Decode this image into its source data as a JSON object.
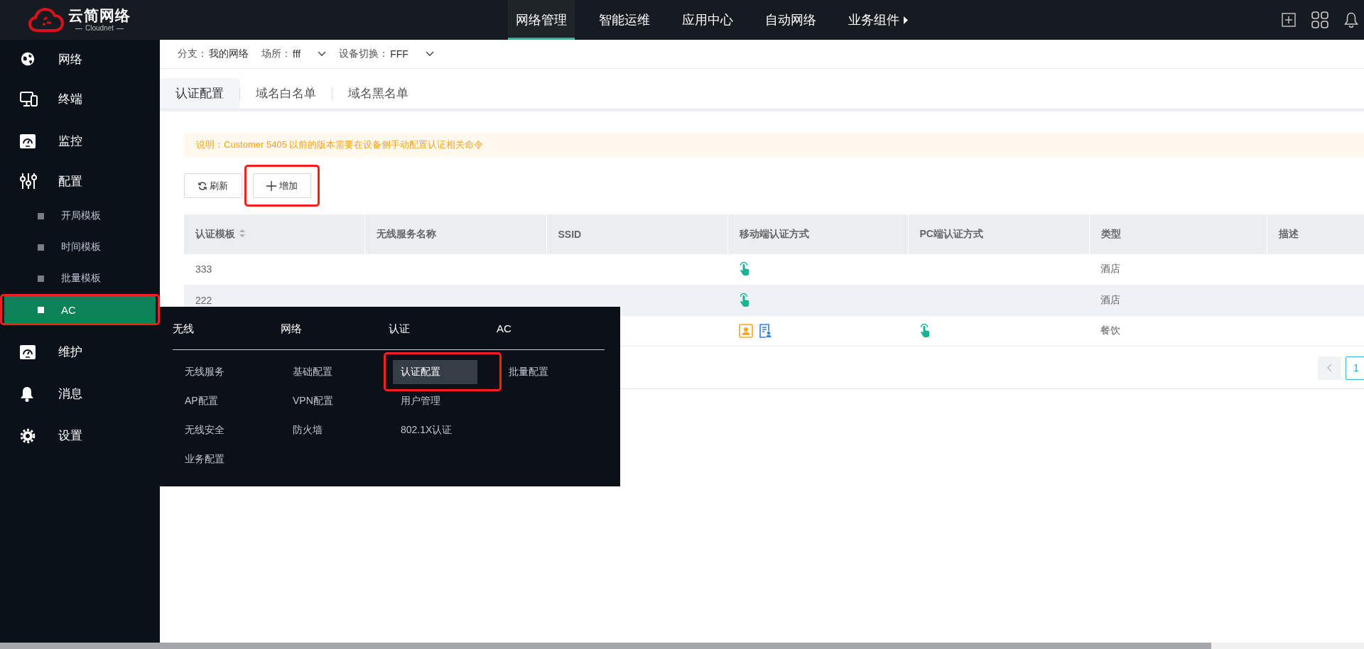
{
  "topbar": {
    "logo": {
      "name": "云简网络",
      "tagline": "Cloudnet"
    },
    "nav": [
      {
        "label": "网络管理",
        "selected": true,
        "submenu": false
      },
      {
        "label": "智能运维",
        "selected": false,
        "submenu": false
      },
      {
        "label": "应用中心",
        "selected": false,
        "submenu": false
      },
      {
        "label": "自动网络",
        "selected": false,
        "submenu": false
      },
      {
        "label": "业务组件",
        "selected": false,
        "submenu": true
      }
    ]
  },
  "sidebar": {
    "items": [
      {
        "label": "网络",
        "selected": false
      },
      {
        "label": "终端",
        "selected": false
      },
      {
        "label": "监控",
        "selected": false
      },
      {
        "label": "配置",
        "selected": false,
        "children": [
          {
            "label": "开局模板",
            "selected": false,
            "annotated": false
          },
          {
            "label": "时间模板",
            "selected": false,
            "annotated": false
          },
          {
            "label": "批量模板",
            "selected": false,
            "annotated": false
          },
          {
            "label": "AC",
            "selected": true,
            "annotated": true
          }
        ]
      },
      {
        "label": "维护",
        "selected": false
      },
      {
        "label": "消息",
        "selected": false
      },
      {
        "label": "设置",
        "selected": false
      }
    ]
  },
  "filters": [
    {
      "label": "分支：",
      "value": "我的网络",
      "dropdown": false
    },
    {
      "label": "场所：",
      "value": "fff",
      "dropdown": true
    },
    {
      "label": "设备切换：",
      "value": "FFF",
      "dropdown": true
    }
  ],
  "tabs": [
    {
      "label": "认证配置",
      "selected": true
    },
    {
      "label": "域名白名单",
      "selected": false
    },
    {
      "label": "域名黑名单",
      "selected": false
    }
  ],
  "notice": "说明：Customer 5405 以前的版本需要在设备侧手动配置认证相关命令",
  "toolbar": [
    {
      "kind": "refresh",
      "label": "刷新",
      "annotated": false
    },
    {
      "kind": "add",
      "label": "增加",
      "annotated": true
    }
  ],
  "table": {
    "columns": [
      {
        "label": "认证模板",
        "sortable": true
      },
      {
        "label": "无线服务名称",
        "sortable": false
      },
      {
        "label": "SSID",
        "sortable": false
      },
      {
        "label": "移动端认证方式",
        "sortable": false
      },
      {
        "label": "PC端认证方式",
        "sortable": false
      },
      {
        "label": "类型",
        "sortable": false
      },
      {
        "label": "描述",
        "sortable": false
      }
    ],
    "rows": [
      {
        "highlighted": false,
        "template": "333",
        "mobile_auth": [
          {
            "kind": "tap"
          }
        ],
        "type": "酒店"
      },
      {
        "highlighted": true,
        "template": "222",
        "mobile_auth": [
          {
            "kind": "tap"
          }
        ],
        "type": "酒店"
      },
      {
        "highlighted": false,
        "mobile_auth": [
          {
            "kind": "account"
          },
          {
            "kind": "form"
          }
        ],
        "pc_auth": [
          {
            "kind": "tap"
          }
        ],
        "type": "餐饮"
      }
    ]
  },
  "pagination": {
    "pages": [
      {
        "label": "1",
        "selected": true
      }
    ]
  },
  "flyout": {
    "columns": [
      {
        "title": "无线",
        "items": [
          {
            "label": "无线服务",
            "selected": false,
            "annotated": false
          },
          {
            "label": "AP配置",
            "selected": false,
            "annotated": false
          },
          {
            "label": "无线安全",
            "selected": false,
            "annotated": false
          },
          {
            "label": "业务配置",
            "selected": false,
            "annotated": false
          }
        ]
      },
      {
        "title": "网络",
        "items": [
          {
            "label": "基础配置",
            "selected": false,
            "annotated": false
          },
          {
            "label": "VPN配置",
            "selected": false,
            "annotated": false
          },
          {
            "label": "防火墙",
            "selected": false,
            "annotated": false
          }
        ]
      },
      {
        "title": "认证",
        "items": [
          {
            "label": "认证配置",
            "selected": true,
            "annotated": true
          },
          {
            "label": "用户管理",
            "selected": false,
            "annotated": false
          },
          {
            "label": "802.1X认证",
            "selected": false,
            "annotated": false
          }
        ]
      },
      {
        "title": "AC",
        "items": [
          {
            "label": "批量配置",
            "selected": false,
            "annotated": false
          }
        ]
      }
    ]
  }
}
